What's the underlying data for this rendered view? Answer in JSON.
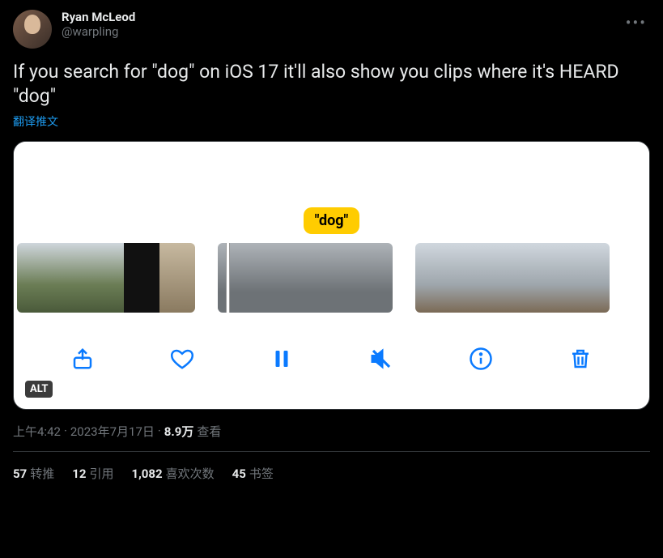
{
  "user": {
    "display_name": "Ryan McLeod",
    "handle": "@warpling"
  },
  "body": "If you search for \"dog\" on iOS 17 it'll also show you clips where it's HEARD \"dog\"",
  "translate_label": "翻译推文",
  "media": {
    "chip": "\"dog\"",
    "alt_badge": "ALT"
  },
  "meta": {
    "time": "上午4:42",
    "dot1": " · ",
    "date": "2023年7月17日",
    "dot2": " · ",
    "views_num": "8.9万",
    "views_label": " 查看"
  },
  "stats": {
    "retweets_num": "57",
    "retweets_label": "转推",
    "quotes_num": "12",
    "quotes_label": "引用",
    "likes_num": "1,082",
    "likes_label": "喜欢次数",
    "bookmarks_num": "45",
    "bookmarks_label": "书签"
  }
}
